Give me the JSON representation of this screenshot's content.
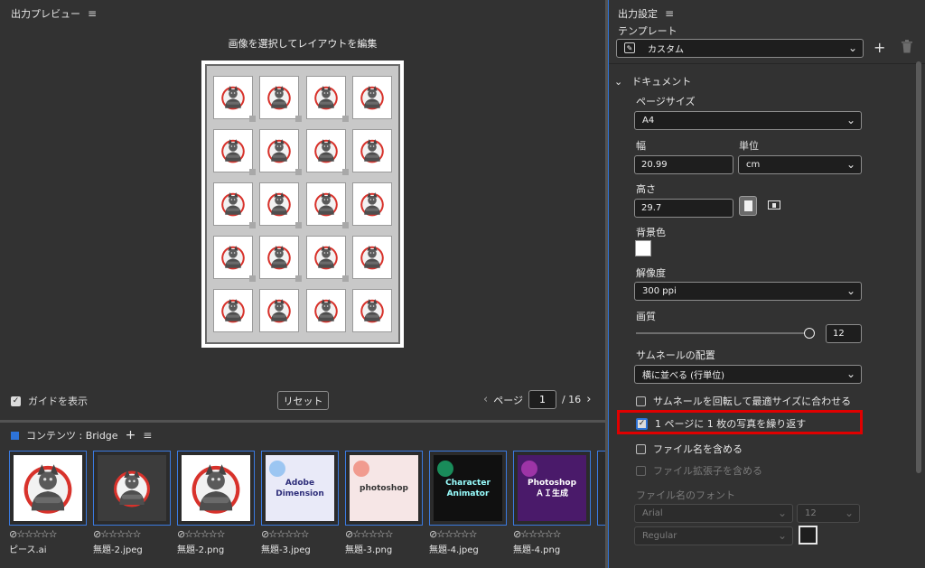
{
  "preview": {
    "title": "出力プレビュー",
    "hint": "画像を選択してレイアウトを編集",
    "guide_label": "ガイドを表示",
    "guide_checked": true,
    "reset_label": "リセット",
    "page_label": "ページ",
    "page_current": "1",
    "page_total": "/ 16"
  },
  "content": {
    "title": "コンテンツ : Bridge",
    "thumbs": [
      {
        "name": "ピース.ai",
        "rating": "⊘☆☆☆☆☆"
      },
      {
        "name": "無題-2.jpeg",
        "rating": "⊘☆☆☆☆☆"
      },
      {
        "name": "無題-2.png",
        "rating": "⊘☆☆☆☆☆"
      },
      {
        "name": "無題-3.jpeg",
        "rating": "⊘☆☆☆☆☆",
        "text": "Adobe\nDimension"
      },
      {
        "name": "無題-3.png",
        "rating": "⊘☆☆☆☆☆",
        "text": "photoshop"
      },
      {
        "name": "無題-4.jpeg",
        "rating": "⊘☆☆☆☆☆",
        "text": "Character Animator"
      },
      {
        "name": "無題-4.png",
        "rating": "⊘☆☆☆☆☆",
        "text": "Photoshop\nＡＩ生成"
      }
    ]
  },
  "settings": {
    "title": "出力設定",
    "template_label": "テンプレート",
    "template_value": "カスタム",
    "document_label": "ドキュメント",
    "page_size_label": "ページサイズ",
    "page_size_value": "A4",
    "width_label": "幅",
    "width_value": "20.99",
    "unit_label": "単位",
    "unit_value": "cm",
    "height_label": "高さ",
    "height_value": "29.7",
    "bg_color_label": "背景色",
    "bg_color": "#ffffff",
    "resolution_label": "解像度",
    "resolution_value": "300 ppi",
    "quality_label": "画質",
    "quality_value": "12",
    "quality_fraction": 1.0,
    "thumb_layout_label": "サムネールの配置",
    "thumb_layout_value": "横に並べる (行単位)",
    "rotate_label": "サムネールを回転して最適サイズに合わせる",
    "rotate_checked": false,
    "repeat_label": "1 ページに 1 枚の写真を繰り返す",
    "repeat_checked": true,
    "filename_label": "ファイル名を含める",
    "filename_checked": false,
    "ext_label": "ファイル拡張子を含める",
    "ext_checked": false,
    "font_label": "ファイル名のフォント",
    "font_value": "Arial",
    "font_size_value": "12",
    "font_style_value": "Regular"
  },
  "colors": {
    "accent": "#2d73d8",
    "highlight": "#e00000",
    "panel_bg": "#323232"
  }
}
